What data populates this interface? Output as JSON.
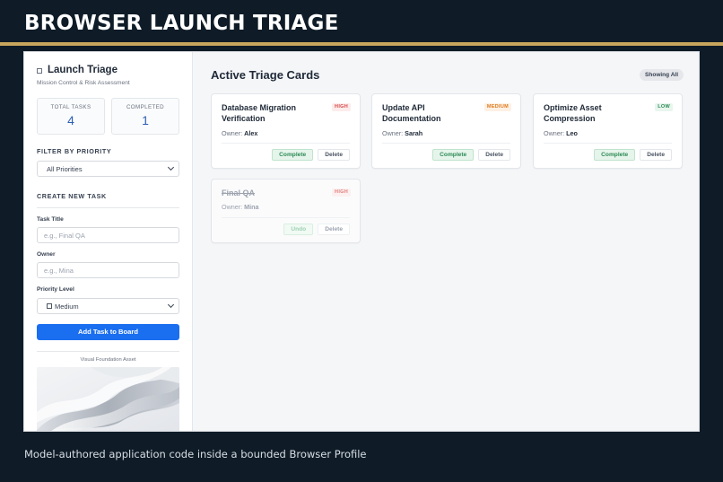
{
  "page": {
    "title": "BROWSER LAUNCH TRIAGE",
    "caption": "Model-authored application code inside a bounded Browser Profile"
  },
  "sidebar": {
    "app_name": "Launch Triage",
    "app_subtitle": "Mission Control & Risk Assessment",
    "stats": [
      {
        "label": "TOTAL TASKS",
        "value": "4"
      },
      {
        "label": "COMPLETED",
        "value": "1"
      }
    ],
    "filter": {
      "heading": "FILTER BY PRIORITY",
      "selected": "All Priorities"
    },
    "create": {
      "heading": "CREATE NEW TASK",
      "title_label": "Task Title",
      "title_placeholder": "e.g., Final QA",
      "owner_label": "Owner",
      "owner_placeholder": "e.g., Mina",
      "priority_label": "Priority Level",
      "priority_selected": "Medium",
      "submit_label": "Add Task to Board"
    },
    "asset_caption": "Visual Foundation Asset"
  },
  "main": {
    "title": "Active Triage Cards",
    "showing_badge": "Showing All",
    "owner_prefix": "Owner:",
    "cards": [
      {
        "title": "Database Migration Verification",
        "priority": "HIGH",
        "owner": "Alex",
        "action": "Complete",
        "delete": "Delete",
        "done": false
      },
      {
        "title": "Update API Documentation",
        "priority": "MEDIUM",
        "owner": "Sarah",
        "action": "Complete",
        "delete": "Delete",
        "done": false
      },
      {
        "title": "Optimize Asset Compression",
        "priority": "LOW",
        "owner": "Leo",
        "action": "Complete",
        "delete": "Delete",
        "done": false
      },
      {
        "title": "Final QA",
        "priority": "HIGH",
        "owner": "Mina",
        "action": "Undo",
        "delete": "Delete",
        "done": true
      }
    ]
  },
  "colors": {
    "background": "#0f1c28",
    "gold_accent": "#c8a65c",
    "primary_button": "#1a6ef0",
    "stat_value": "#2c5fb3",
    "high": "#d94848",
    "medium": "#e07b20",
    "low": "#2c8a55"
  },
  "icons": {
    "brand": "square-icon",
    "priority_option": "square-icon",
    "select": "chevron-down-icon"
  }
}
